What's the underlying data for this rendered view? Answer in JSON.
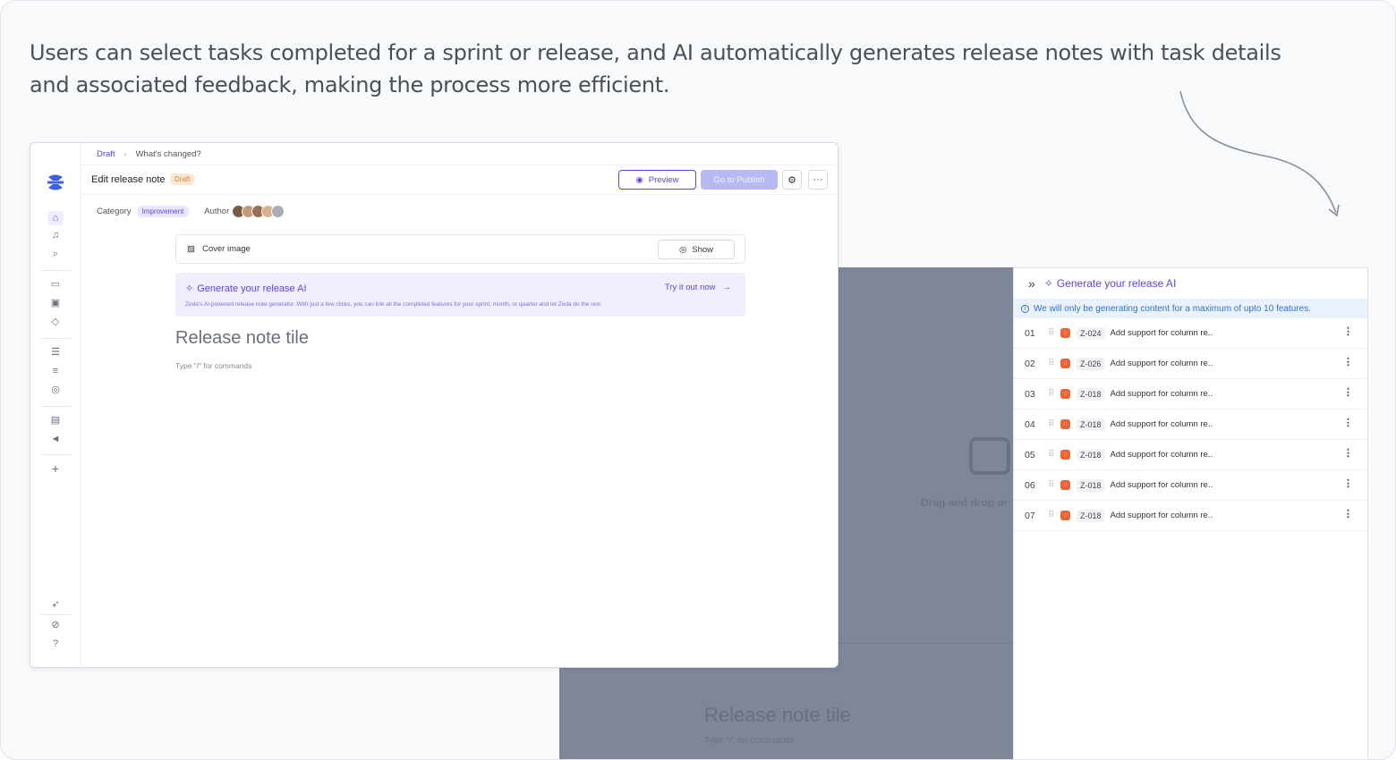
{
  "caption": "Users can select tasks completed for a sprint or release, and AI automatically generates release notes with task details and associated feedback, making the process more efficient.",
  "editor": {
    "breadcrumb": {
      "parent": "Draft",
      "current": "What's changed?"
    },
    "title": "Edit release note",
    "status_badge": "Draft",
    "preview_label": "Preview",
    "publish_label": "Go to Publish",
    "meta": {
      "category_label": "Category",
      "category_value": "Improvement",
      "author_label": "Author"
    },
    "cover": {
      "label": "Cover image",
      "show_label": "Show"
    },
    "ai_banner": {
      "title": "Generate your release AI",
      "cta": "Try it out now",
      "description": "Zeda's AI-powered release note generator. With just a few clicks, you can link all the completed features for your sprint, month, or quarter and let Zeda do the rest."
    },
    "release_title_placeholder": "Release note tile",
    "command_hint": "Type \"/\" for commands"
  },
  "ai_panel": {
    "title": "Generate your release AI",
    "info": "We will only be generating content for a maximum of upto 10 features.",
    "tasks": [
      {
        "num": "01",
        "key": "Z-024",
        "title": "Add support for column re.."
      },
      {
        "num": "02",
        "key": "Z-026",
        "title": "Add support for column re.."
      },
      {
        "num": "03",
        "key": "Z-018",
        "title": "Add support for column re.."
      },
      {
        "num": "04",
        "key": "Z-018",
        "title": "Add support for column re.."
      },
      {
        "num": "05",
        "key": "Z-018",
        "title": "Add support for column re.."
      },
      {
        "num": "06",
        "key": "Z-018",
        "title": "Add support for column re.."
      },
      {
        "num": "07",
        "key": "Z-018",
        "title": "Add support for column re.."
      }
    ]
  },
  "background_ghost": {
    "title": "Release note tile",
    "drop_text": "Drag and drop or",
    "command_hint": "Type \"/\" for commands"
  },
  "colors": {
    "accent": "#5b46e0",
    "draft_badge": "#fde9d3",
    "source_icon": "#f06330",
    "info_bg": "#eaf3fd"
  }
}
